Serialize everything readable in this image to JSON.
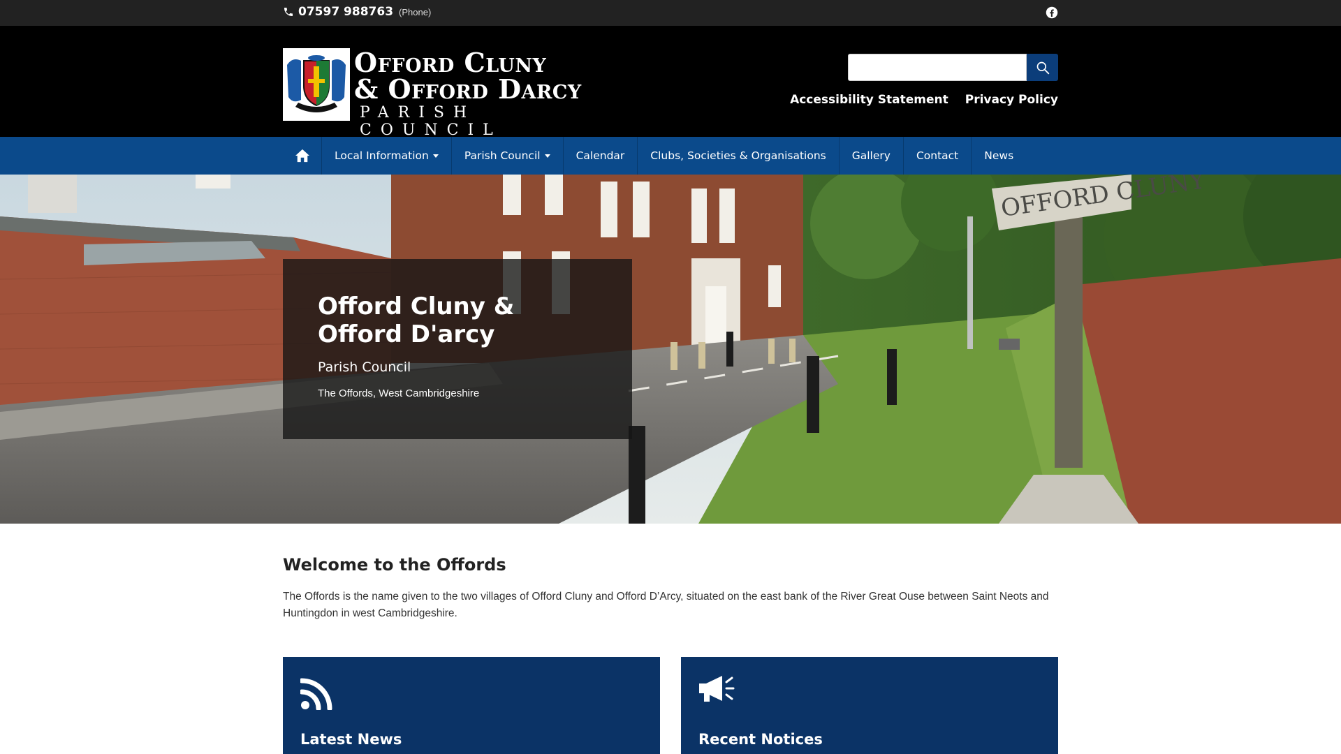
{
  "topbar": {
    "phone_number": "07597 988763",
    "phone_type": "(Phone)",
    "social_icon": "facebook-icon"
  },
  "header": {
    "logo": {
      "line1": "Offord Cluny",
      "line2": "& Offord Darcy",
      "line3": "PARISH COUNCIL"
    },
    "search": {
      "placeholder": "",
      "value": "",
      "icon": "search-icon"
    },
    "links": [
      "Accessibility Statement",
      "Privacy Policy"
    ]
  },
  "nav": {
    "home_icon": "home-icon",
    "items": [
      {
        "label": "Local Information",
        "dropdown": true
      },
      {
        "label": "Parish Council",
        "dropdown": true
      },
      {
        "label": "Calendar",
        "dropdown": false
      },
      {
        "label": "Clubs, Societies & Organisations",
        "dropdown": false
      },
      {
        "label": "Gallery",
        "dropdown": false
      },
      {
        "label": "Contact",
        "dropdown": false
      },
      {
        "label": "News",
        "dropdown": false
      }
    ]
  },
  "hero": {
    "title": "Offord Cluny & Offord D'arcy",
    "subtitle": "Parish Council",
    "location": "The Offords, West Cambridgeshire"
  },
  "welcome": {
    "heading": "Welcome to the Offords",
    "body": "The Offords is the name given to the two villages of Offord Cluny and Offord D’Arcy, situated on the east bank of the River Great Ouse between Saint Neots and Huntingdon in west Cambridgeshire."
  },
  "cards": [
    {
      "title": "Latest News",
      "icon": "rss-icon"
    },
    {
      "title": "Recent Notices",
      "icon": "megaphone-icon"
    }
  ],
  "colors": {
    "topbar": "#222222",
    "header": "#000000",
    "nav": "#0b4a8b",
    "card": "#0b3366"
  }
}
